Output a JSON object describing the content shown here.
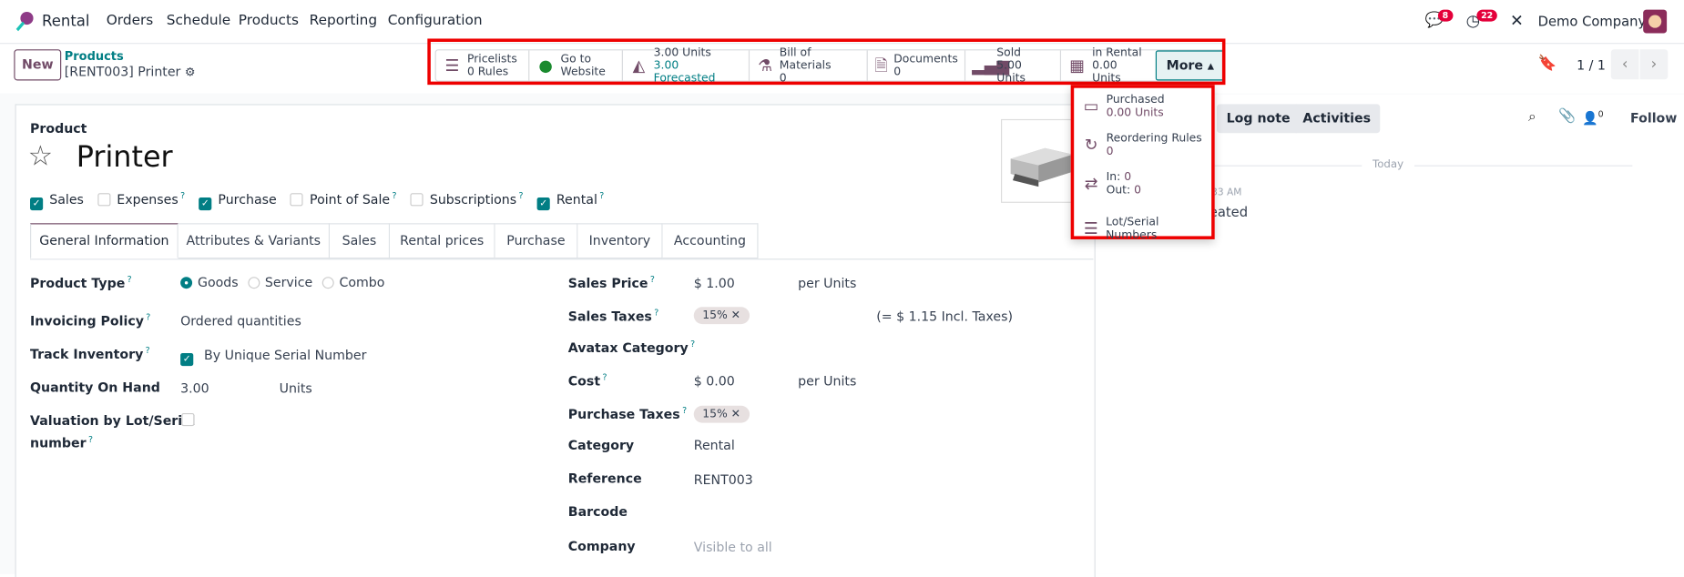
{
  "nav": {
    "app": "Rental",
    "menu": [
      "Orders",
      "Schedule",
      "Products",
      "Reporting",
      "Configuration"
    ],
    "messages_badge": "8",
    "activities_badge": "22",
    "company": "Demo Company"
  },
  "control": {
    "new_label": "New",
    "breadcrumb_parent": "Products",
    "breadcrumb_current": "[RENT003] Printer",
    "pager": "1 / 1"
  },
  "smart_buttons": [
    {
      "icon": "list-icon",
      "label": "Pricelists",
      "value": "0 Rules"
    },
    {
      "icon": "globe-icon",
      "label": "Go to",
      "value": "Website"
    },
    {
      "icon": "area-chart-icon",
      "label": "3.00 Units",
      "value": "3.00 Forecasted"
    },
    {
      "icon": "flask-icon",
      "label": "Bill of Materials",
      "value": "0"
    },
    {
      "icon": "document-icon",
      "label": "Documents",
      "value": "0"
    },
    {
      "icon": "signal-icon",
      "label": "Sold",
      "value": "5.00 Units"
    },
    {
      "icon": "calendar-icon",
      "label": "in Rental",
      "value": "0.00 Units"
    }
  ],
  "more_label": "More",
  "more_menu": [
    {
      "icon": "credit-card-icon",
      "label": "Purchased",
      "value": "0.00 Units"
    },
    {
      "icon": "refresh-icon",
      "label": "Reordering Rules",
      "value": "0"
    },
    {
      "icon": "exchange-icon",
      "label": "In:",
      "value": "0",
      "label2": "Out:",
      "value2": "0"
    },
    {
      "icon": "bars-icon",
      "label": "Lot/Serial Numbers"
    }
  ],
  "form": {
    "type_label": "Product",
    "name": "Printer",
    "flags": [
      {
        "label": "Sales",
        "checked": true,
        "help": false
      },
      {
        "label": "Expenses",
        "checked": false,
        "help": true
      },
      {
        "label": "Purchase",
        "checked": true,
        "help": false
      },
      {
        "label": "Point of Sale",
        "checked": false,
        "help": true
      },
      {
        "label": "Subscriptions",
        "checked": false,
        "help": true
      },
      {
        "label": "Rental",
        "checked": true,
        "help": true
      }
    ],
    "tabs": [
      "General Information",
      "Attributes & Variants",
      "Sales",
      "Rental prices",
      "Purchase",
      "Inventory",
      "Accounting"
    ],
    "left": {
      "product_type": {
        "label": "Product Type",
        "options": [
          "Goods",
          "Service",
          "Combo"
        ],
        "selected": "Goods"
      },
      "invoicing_policy": {
        "label": "Invoicing Policy",
        "value": "Ordered quantities"
      },
      "track_inventory": {
        "label": "Track Inventory",
        "checked": true,
        "value": "By Unique Serial Number"
      },
      "qty_on_hand": {
        "label": "Quantity On Hand",
        "value": "3.00",
        "unit": "Units"
      },
      "valuation": {
        "label1": "Valuation by Lot/Serial",
        "label2": "number",
        "checked": false
      }
    },
    "right": {
      "sales_price": {
        "label": "Sales Price",
        "value": "$ 1.00",
        "unit": "per Units"
      },
      "sales_taxes": {
        "label": "Sales Taxes",
        "tag": "15%",
        "incl": "(= $ 1.15 Incl. Taxes)"
      },
      "avatax": {
        "label": "Avatax Category"
      },
      "cost": {
        "label": "Cost",
        "value": "$ 0.00",
        "unit": "per Units"
      },
      "purchase_taxes": {
        "label": "Purchase Taxes",
        "tag": "15%"
      },
      "category": {
        "label": "Category",
        "value": "Rental"
      },
      "reference": {
        "label": "Reference",
        "value": "RENT003"
      },
      "barcode": {
        "label": "Barcode"
      },
      "company": {
        "label": "Company",
        "placeholder": "Visible to all"
      }
    }
  },
  "chatter": {
    "log_note": "Log note",
    "activities": "Activities",
    "followers_count": "0",
    "follow": "Follow",
    "date_sep": "Today",
    "msg_time_fragment": "33 AM",
    "msg_body_fragment": "eated"
  },
  "colors": {
    "brand": "#714b67",
    "accent": "#017e84",
    "highlight": "#ee0000"
  }
}
